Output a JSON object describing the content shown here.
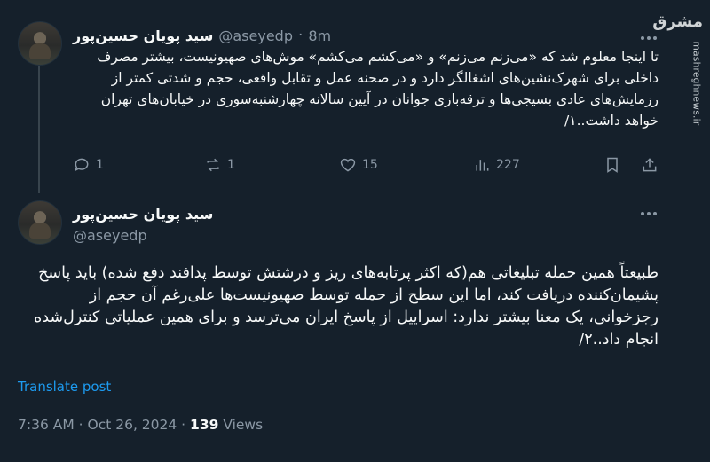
{
  "watermark": {
    "logo": "مشرق",
    "url": "mashreghnews.ir"
  },
  "tweet1": {
    "name": "سید پویان حسین‌پور",
    "handle": "@aseyedp",
    "separator": "·",
    "time": "8m",
    "text": "تا اینجا معلوم شد که «می‌زنم می‌زنم» و «می‌کشم می‌کشم» موش‌های صهیونیست، بیشتر مصرف داخلی برای شهرک‌نشین‌های اشغالگر دارد و در صحنه عمل و تقابل واقعی، حجم و شدتی کمتر از رزمایش‌های عادی بسیجی‌ها و ترقه‌بازی جوانان در آیین سالانه چهارشنبه‌سوری در خیابان‌های تهران خواهد داشت..۱/",
    "actions": {
      "replies": "1",
      "reposts": "1",
      "likes": "15",
      "views": "227"
    }
  },
  "tweet2": {
    "name": "سید پویان حسین‌پور",
    "handle": "@aseyedp",
    "text": "طبیعتاً همین حمله تبلیغاتی هم(که اکثر پرتابه‌های ریز و درشتش توسط پدافند دفع شده) باید پاسخ پشیمان‌کننده دریافت کند، اما این سطح از حمله توسط صهیونیست‌ها علی‌رغم آن حجم از رجزخوانی، یک معنا بیشتر ندارد: اسراییل از پاسخ ایران می‌ترسد و برای همین عملیاتی کنترل‌شده انجام داد..۲/",
    "translate": "Translate post",
    "timestamp": "7:36 AM · Oct 26, 2024 · ",
    "views_count": "139",
    "views_label": " Views"
  }
}
